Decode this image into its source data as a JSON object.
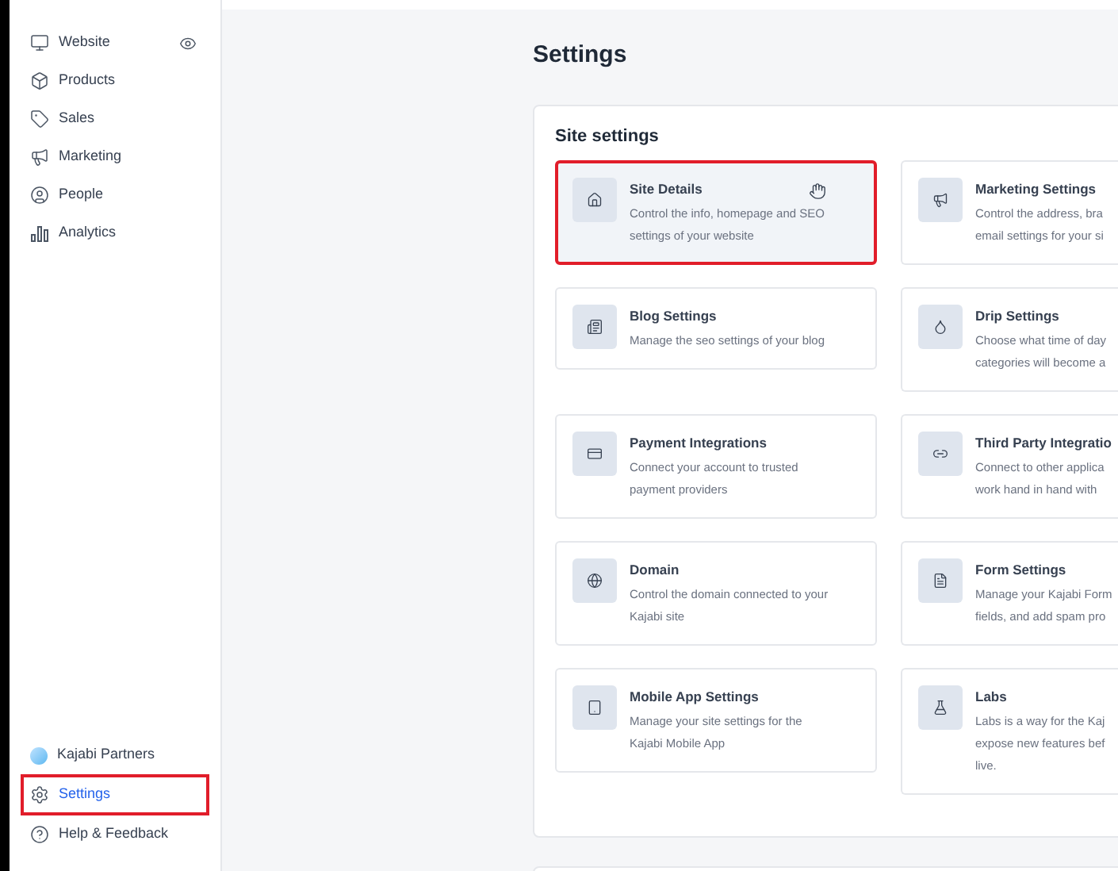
{
  "sidebar": {
    "items": [
      {
        "label": "Website",
        "selected": false,
        "highlighted": false,
        "preview": true
      },
      {
        "label": "Products",
        "selected": false,
        "highlighted": false
      },
      {
        "label": "Sales",
        "selected": false,
        "highlighted": false
      },
      {
        "label": "Marketing",
        "selected": false,
        "highlighted": false
      },
      {
        "label": "People",
        "selected": false,
        "highlighted": false
      },
      {
        "label": "Analytics",
        "selected": false,
        "highlighted": false
      }
    ],
    "bottom_items": [
      {
        "label": "Kajabi Partners",
        "selected": false,
        "highlighted": false
      },
      {
        "label": "Settings",
        "selected": true,
        "highlighted": true
      },
      {
        "label": "Help & Feedback",
        "selected": false,
        "highlighted": false
      }
    ]
  },
  "page": {
    "title": "Settings"
  },
  "site_settings": {
    "title": "Site settings",
    "cards": [
      {
        "title": "Site Details",
        "description": [
          "Control the info, homepage and SEO",
          "settings of your website"
        ],
        "selected": true,
        "highlighted": true
      },
      {
        "title": "Marketing Settings",
        "description": [
          "Control the address, bra",
          "email settings for your si"
        ],
        "selected": false,
        "highlighted": false
      },
      {
        "title": "Blog Settings",
        "description": [
          "Manage the seo settings of your blog"
        ],
        "selected": false,
        "highlighted": false
      },
      {
        "title": "Drip Settings",
        "description": [
          "Choose what time of day",
          "categories will become a"
        ],
        "selected": false,
        "highlighted": false
      },
      {
        "title": "Payment Integrations",
        "description": [
          "Connect your account to trusted",
          "payment providers"
        ],
        "selected": false,
        "highlighted": false
      },
      {
        "title": "Third Party Integratio",
        "description": [
          "Connect to other applica",
          "work hand in hand with"
        ],
        "selected": false,
        "highlighted": false
      },
      {
        "title": "Domain",
        "description": [
          "Control the domain connected to your",
          "Kajabi site"
        ],
        "selected": false,
        "highlighted": false
      },
      {
        "title": "Form Settings",
        "description": [
          "Manage your Kajabi Form",
          "fields, and add spam pro"
        ],
        "selected": false,
        "highlighted": false
      },
      {
        "title": "Mobile App Settings",
        "description": [
          "Manage your site settings for the",
          "Kajabi Mobile App"
        ],
        "selected": false,
        "highlighted": false
      },
      {
        "title": "Labs",
        "description": [
          "Labs is a way for the Kaj",
          "expose new features bef",
          "live."
        ],
        "selected": false,
        "highlighted": false
      }
    ]
  }
}
